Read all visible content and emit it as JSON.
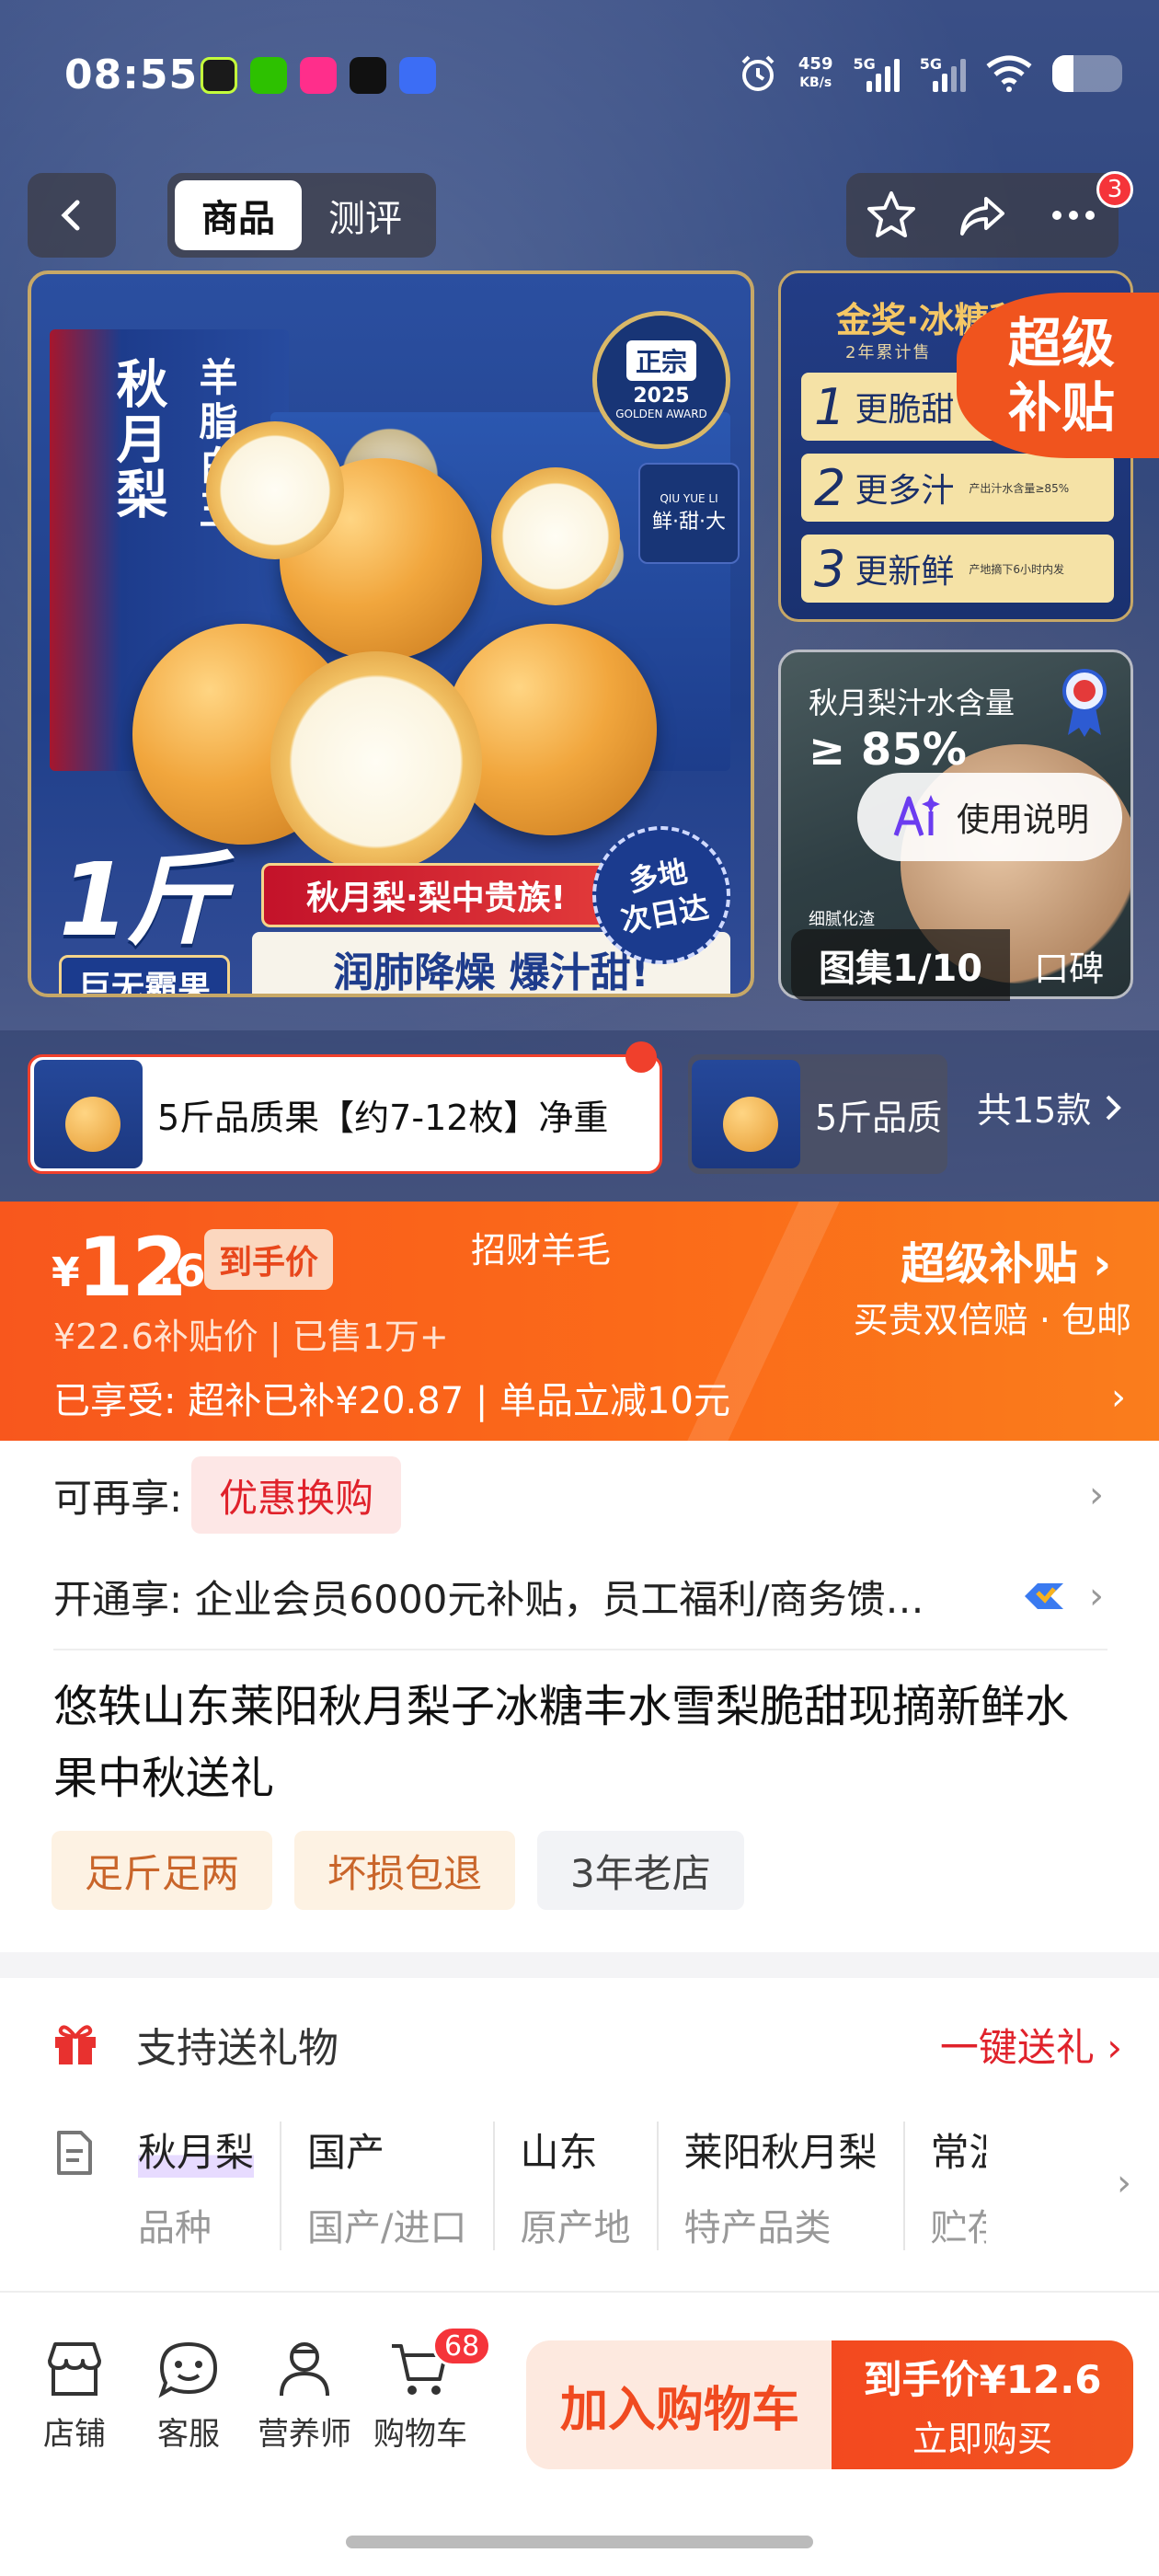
{
  "status": {
    "time": "08:55",
    "speed_value": "459",
    "speed_unit": "KB/s",
    "net1": "5G",
    "net2": "5G",
    "battery_level": 0.3
  },
  "nav": {
    "tabs": [
      "商品",
      "测评"
    ],
    "more_badge": "3"
  },
  "hero": {
    "box_title": "秋月梨",
    "box_subtitle": "羊脂白玉",
    "seal_tag": "正宗",
    "seal_year": "2025",
    "seal_award": "GOLDEN AWARD",
    "qiu_text": "QIU YUE LI",
    "qiu_quality": "鲜·甜·大",
    "banner_red": "秋月梨·梨中贵族!",
    "banner_white": "润肺降燥 爆汁甜!",
    "weight_badge": "1斤+",
    "weight_sub": "巨无霸果",
    "fast_badge_1": "多地",
    "fast_badge_2": "次日达",
    "award_title": "金奖·冰糖秋月",
    "award_sub": "2年累计售",
    "features": [
      {
        "num": "1",
        "text": "更脆甜",
        "note": ""
      },
      {
        "num": "2",
        "text": "更多汁",
        "note": "产出汁水含量≥85%"
      },
      {
        "num": "3",
        "text": "更新鲜",
        "note": "产地摘下6小时内发"
      }
    ],
    "subsidy_1": "超级",
    "subsidy_2": "补贴",
    "juice_title": "秋月梨汁水含量",
    "juice_value": "≥ 85%",
    "juice_foot": "细腻化渣",
    "ai_label": "使用说明",
    "gallery_count": "图集1/10",
    "gallery_review": "口碑"
  },
  "sku": {
    "selected": "5斤品质果【约7-12枚】净重",
    "second": "5斤品质",
    "total": "共15款"
  },
  "price": {
    "currency": "¥",
    "integer": "12",
    "decimal": ".6",
    "tag": "到手价",
    "center_note": "招财羊毛",
    "original": "¥22.6补贴价 | 已售1万+",
    "super_title": "超级补贴",
    "guarantee": "买贵双倍赔 · 包邮",
    "enjoy": "已享受: 超补已补¥20.87 | 单品立减10元"
  },
  "info": {
    "more_label": "可再享:",
    "coupon": "优惠换购",
    "open_label": "开通享: 企业会员6000元补贴，员工福利/商务馈…",
    "title": "悠轶山东莱阳秋月梨子冰糖丰水雪梨脆甜现摘新鲜水果中秋送礼",
    "tags": [
      "足斤足两",
      "坏损包退",
      "3年老店"
    ]
  },
  "gift": {
    "label": "支持送礼物",
    "action": "一键送礼"
  },
  "attrs": [
    {
      "value": "秋月梨",
      "key": "品种"
    },
    {
      "value": "国产",
      "key": "国产/进口"
    },
    {
      "value": "山东",
      "key": "原产地"
    },
    {
      "value": "莱阳秋月梨",
      "key": "特产品类"
    },
    {
      "value": "常温",
      "key": "贮存"
    }
  ],
  "bottom": {
    "store": "店铺",
    "service": "客服",
    "nutrition": "营养师",
    "cart": "购物车",
    "cart_badge": "68",
    "add_cart": "加入购物车",
    "buy_price": "到手价¥12.6",
    "buy_now": "立即购买"
  },
  "colors": {
    "accent": "#f8571d",
    "red": "#e0222b",
    "navy": "#1f3f8a"
  }
}
